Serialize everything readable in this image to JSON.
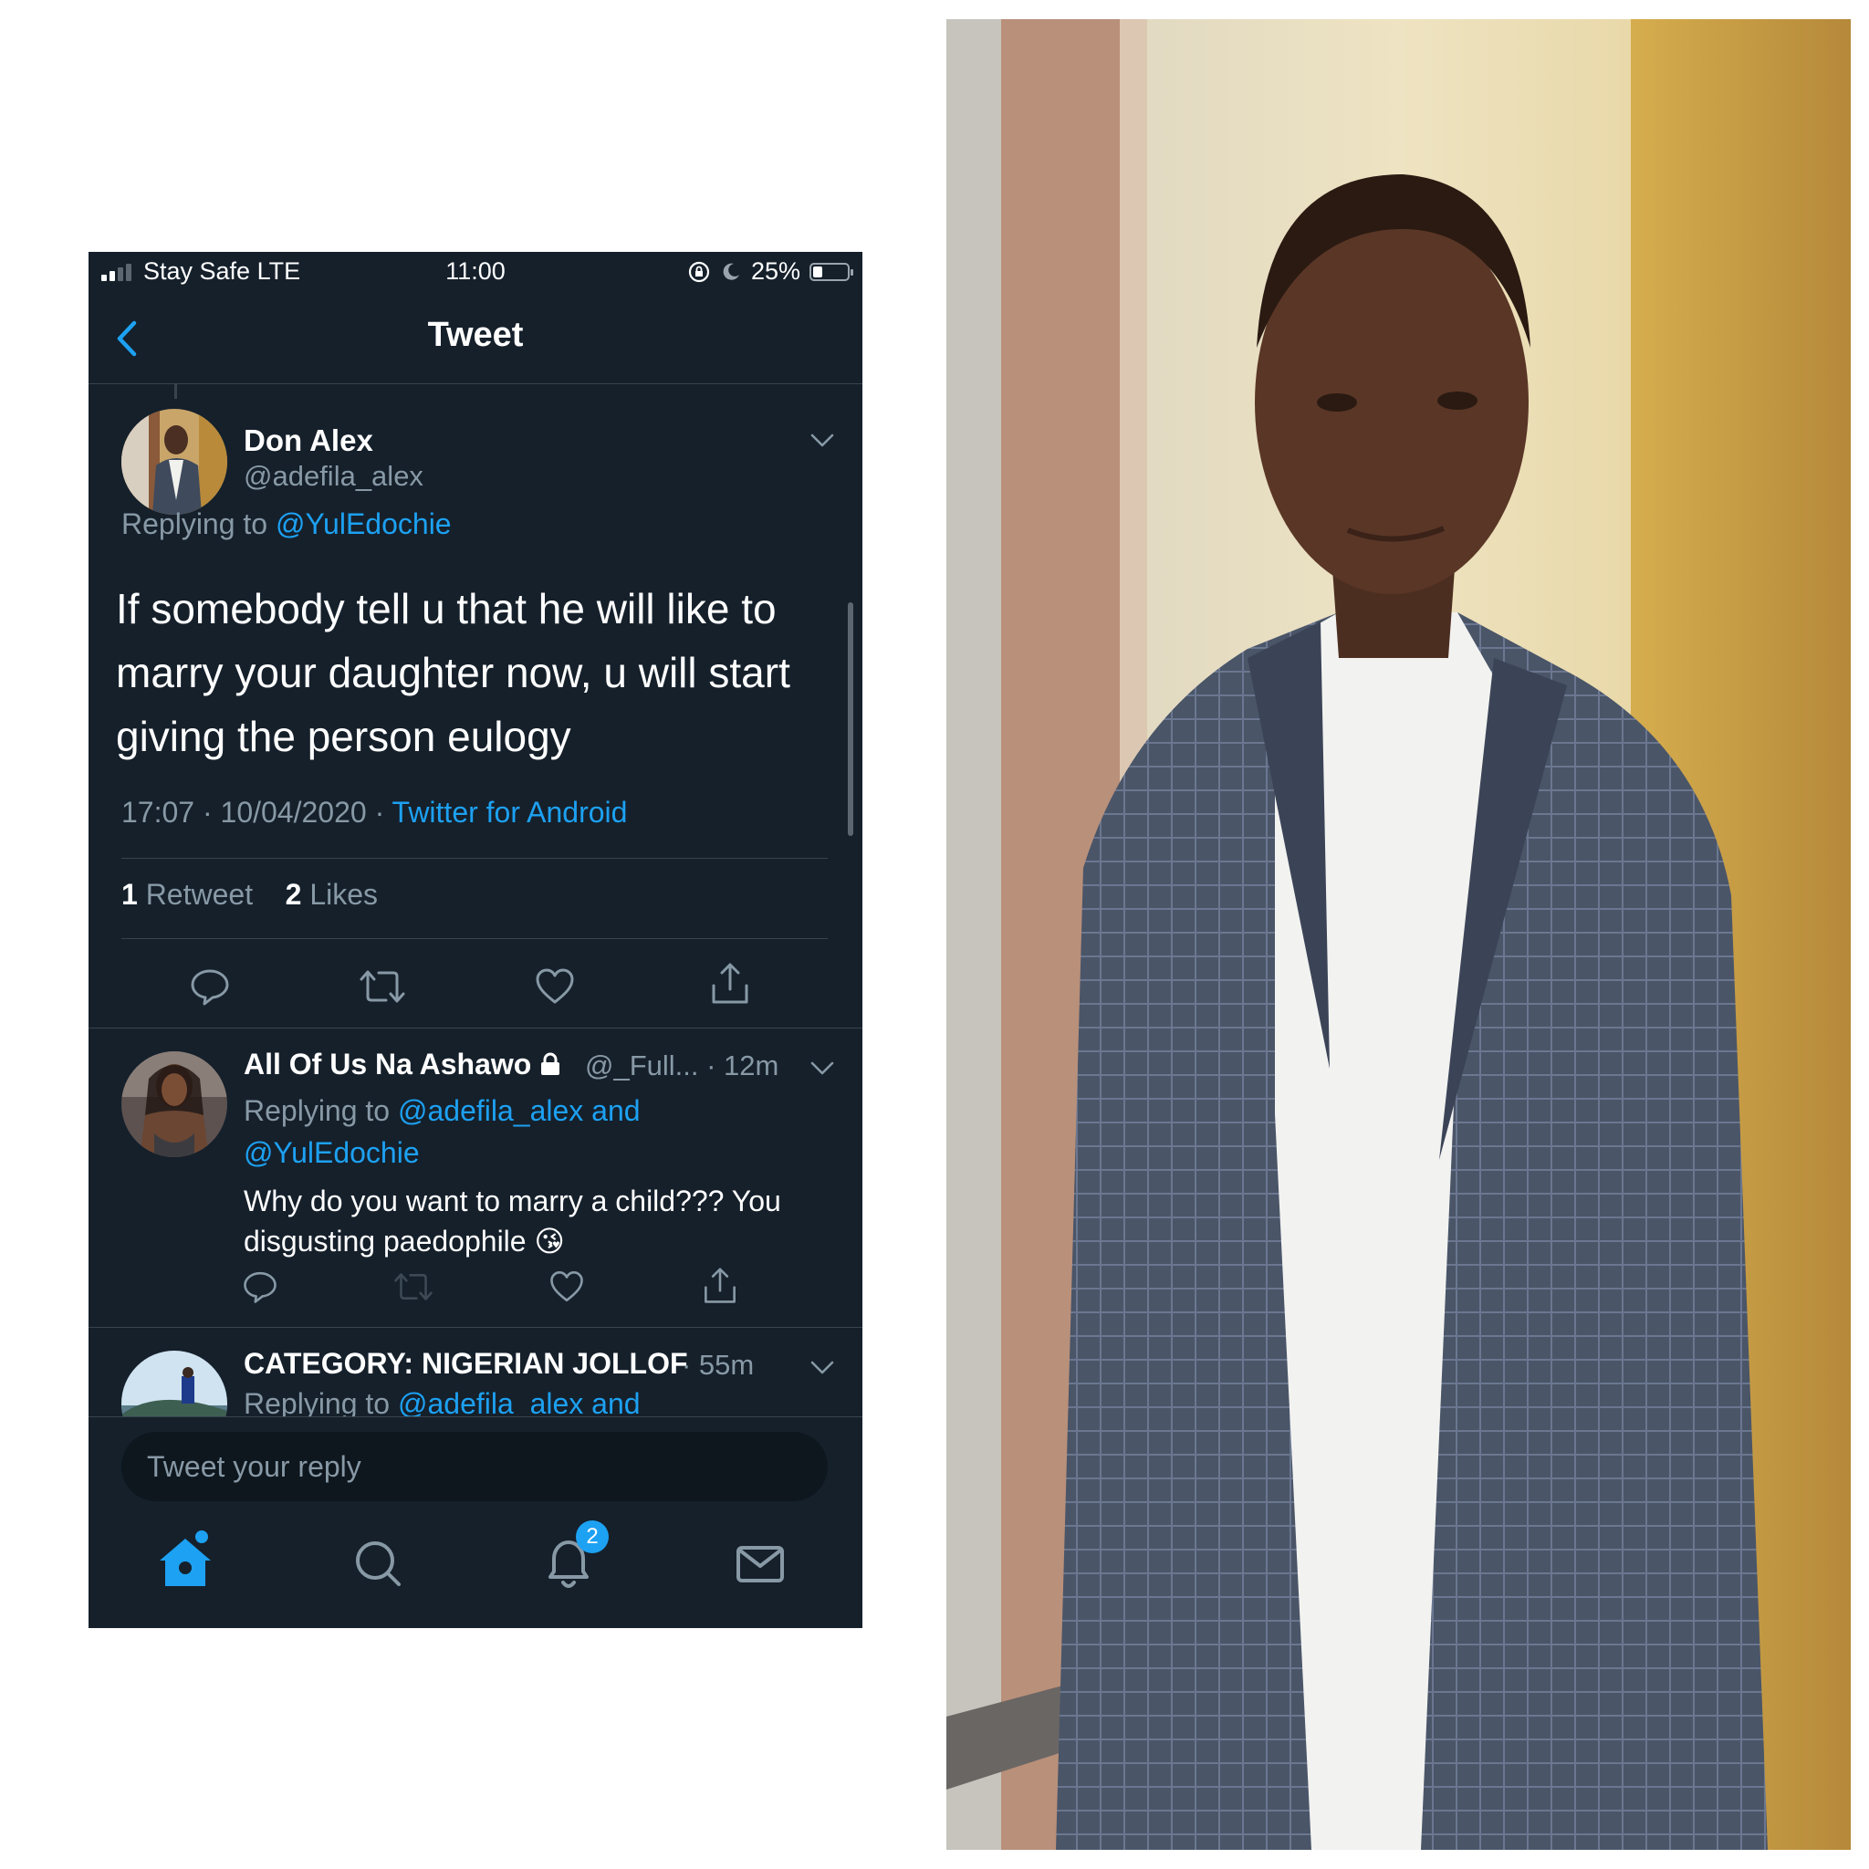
{
  "status_bar": {
    "carrier": "Stay Safe  LTE",
    "time": "11:00",
    "battery": "25%",
    "battery_level": 0.25
  },
  "nav": {
    "title": "Tweet",
    "back_icon": "chevron-left-icon"
  },
  "tweet": {
    "author_name": "Don Alex",
    "author_handle": "@adefila_alex",
    "replying_prefix": "Replying to ",
    "replying_to": "@YulEdochie",
    "text": "If somebody tell u that he will like to marry your daughter now, u will start giving the person eulogy",
    "timestamp": "17:07 · 10/04/2020 · ",
    "source": "Twitter for Android",
    "retweet_count": "1",
    "retweet_label": " Retweet",
    "like_count": "2",
    "like_label": " Likes"
  },
  "replies": [
    {
      "name": "All Of Us Na Ashawo",
      "protected": true,
      "handle": "@_Full... · 12m",
      "replying_prefix": "Replying to ",
      "replying_to_1": "@adefila_alex and",
      "replying_to_2": "@YulEdochie",
      "text": "Why do you want to marry a child??? You disgusting paedophile 😘"
    },
    {
      "name": "CATEGORY: NIGERIAN JOLLOF",
      "handle": " · 55m",
      "replying_prefix": "Replying to ",
      "replying_to_1": "@adefila_alex and"
    }
  ],
  "reply_bar": {
    "placeholder": "Tweet your reply"
  },
  "tabbar": {
    "items": [
      "home-icon",
      "search-icon",
      "notifications-icon",
      "messages-icon"
    ],
    "notification_badge": "2"
  },
  "colors": {
    "background": "#15202b",
    "accent": "#1da1f2",
    "secondary_text": "#8899a6",
    "divider": "#38444d"
  }
}
